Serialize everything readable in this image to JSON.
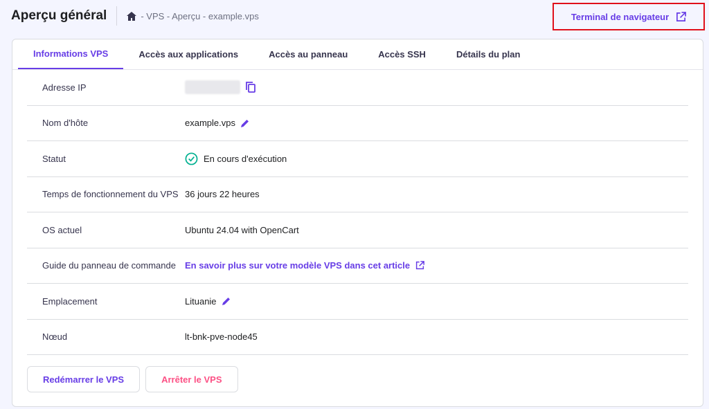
{
  "header": {
    "title": "Aperçu général",
    "breadcrumb": "- VPS - Aperçu - example.vps",
    "terminal_button": "Terminal de navigateur"
  },
  "tabs": [
    {
      "label": "Informations VPS",
      "active": true
    },
    {
      "label": "Accès aux applications"
    },
    {
      "label": "Accès au panneau"
    },
    {
      "label": "Accès SSH"
    },
    {
      "label": "Détails du plan"
    }
  ],
  "rows": {
    "ip": {
      "label": "Adresse IP"
    },
    "hostname": {
      "label": "Nom d'hôte",
      "value": "example.vps"
    },
    "status": {
      "label": "Statut",
      "value": "En cours d'exécution"
    },
    "uptime": {
      "label": "Temps de fonctionnement du VPS",
      "value": "36 jours 22 heures"
    },
    "os": {
      "label": "OS actuel",
      "value": "Ubuntu 24.04 with OpenCart"
    },
    "guide": {
      "label": "Guide du panneau de commande",
      "value": "En savoir plus sur votre modèle VPS dans cet article"
    },
    "location": {
      "label": "Emplacement",
      "value": "Lituanie"
    },
    "node": {
      "label": "Nœud",
      "value": "lt-bnk-pve-node45"
    }
  },
  "actions": {
    "restart": "Redémarrer le VPS",
    "stop": "Arrêter le VPS"
  },
  "colors": {
    "accent": "#673de6",
    "danger": "#fc5185",
    "success": "#00b090"
  }
}
